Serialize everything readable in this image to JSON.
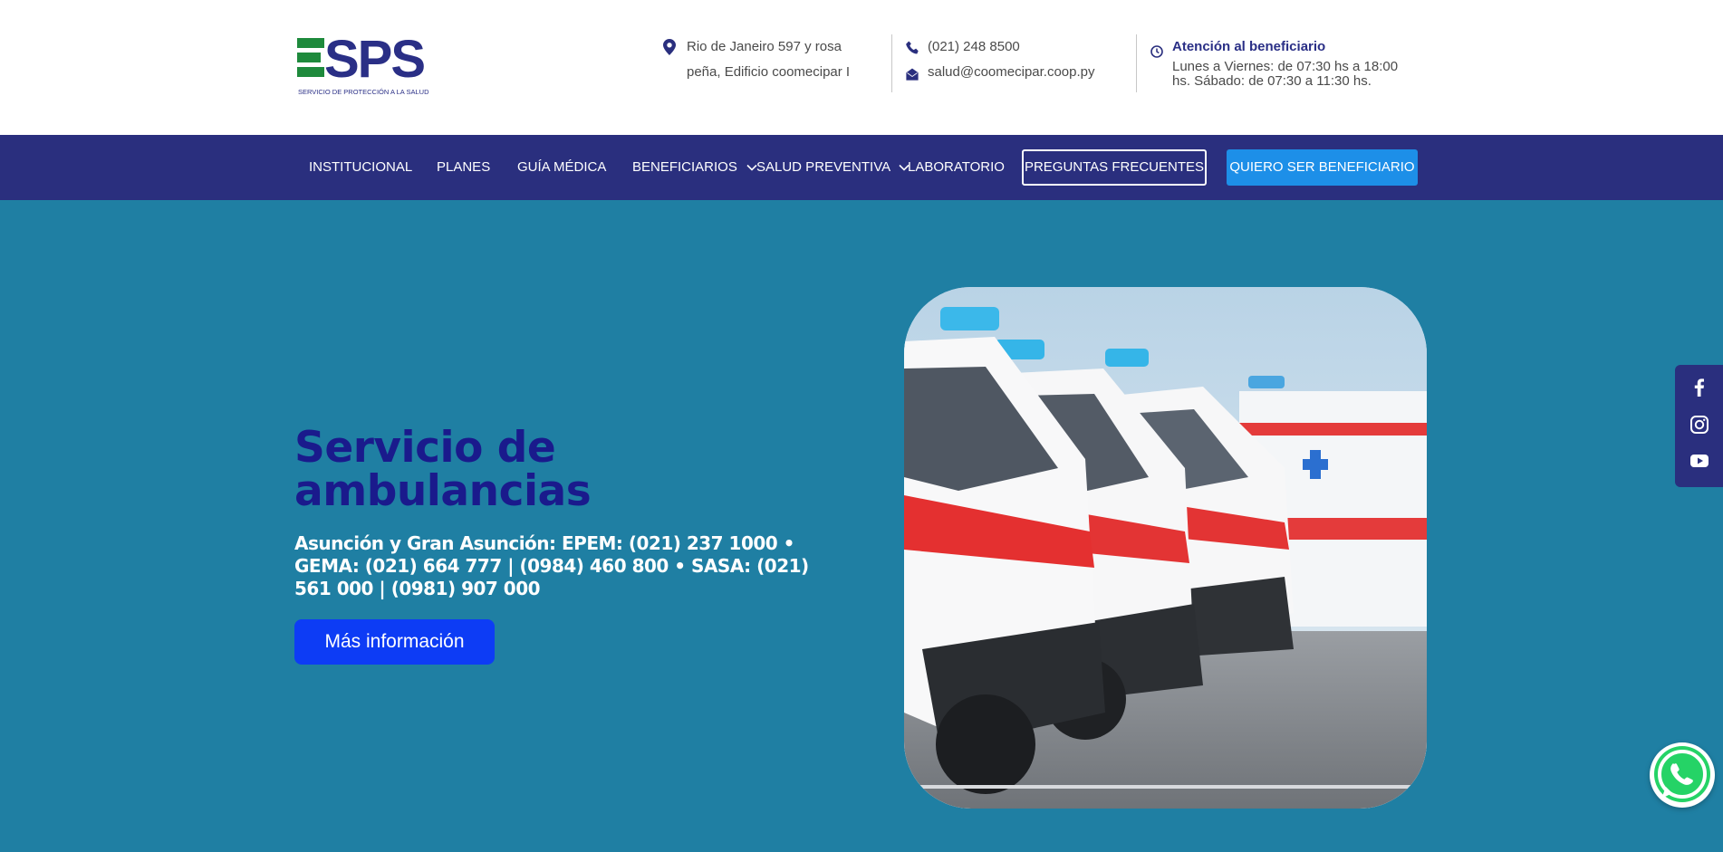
{
  "header": {
    "logo": {
      "letters": "SPS",
      "tagline": "SERVICIO DE PROTECCIÓN A LA SALUD"
    },
    "address": {
      "icon": "map-pin-icon",
      "text": "Rio de Janeiro 597 y rosa peña, Edificio coomecipar I"
    },
    "phone": {
      "icon": "phone-icon",
      "text": "(021) 248 8500"
    },
    "email": {
      "icon": "mail-icon",
      "text": "salud@coomecipar.coop.py"
    },
    "hours": {
      "icon": "clock-icon",
      "title": "Atención al beneficiario",
      "detail": "Lunes a Viernes: de 07:30 hs a 18:00 hs. Sábado: de 07:30 a 11:30 hs."
    }
  },
  "nav": {
    "items": [
      {
        "label": "INSTITUCIONAL"
      },
      {
        "label": "PLANES"
      },
      {
        "label": "GUÍA MÉDICA"
      },
      {
        "label": "BENEFICIARIOS"
      },
      {
        "label": "SALUD PREVENTIVA"
      },
      {
        "label": "LABORATORIO"
      }
    ],
    "faq_button": "PREGUNTAS FRECUENTES",
    "cta_button": "QUIERO SER BENEFICIARIO"
  },
  "hero": {
    "title": "Servicio de ambulancias",
    "subtitle": "Asunción y Gran Asunción: EPEM: (021) 237 1000 • GEMA: (021) 664 777 | (0984) 460 800 • SASA: (021) 561 000 | (0981) 907 000",
    "button": "Más información",
    "image": "ambulances-photo"
  },
  "social": [
    "facebook-icon",
    "instagram-icon",
    "youtube-icon"
  ],
  "floating": {
    "whatsapp": "whatsapp-icon"
  },
  "colors": {
    "brand_navy": "#2a2f7e",
    "brand_green": "#1e8a3c",
    "hero_bg": "#1f7fa3",
    "title_blue": "#1a1a8c",
    "cta_blue": "#1d8fe8",
    "hero_button": "#0d3cf5"
  }
}
